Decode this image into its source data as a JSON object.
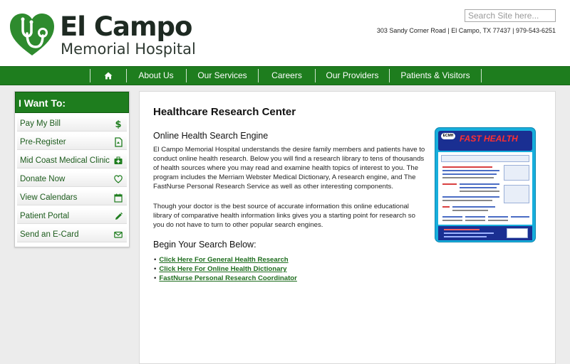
{
  "header": {
    "logo": {
      "name": "El Campo",
      "subtitle": "Memorial Hospital",
      "icon": "heart-stethoscope-icon"
    },
    "search": {
      "placeholder": "Search Site here...",
      "value": ""
    },
    "address": "303 Sandy Corner Road | El Campo, TX 77437 | 979-543-6251"
  },
  "nav": {
    "home_icon": "home-icon",
    "items": [
      "About Us",
      "Our Services",
      "Careers",
      "Our Providers",
      "Patients & Visitors"
    ]
  },
  "sidebar": {
    "title": "I Want To:",
    "items": [
      {
        "label": "Pay My Bill",
        "icon": "dollar-icon"
      },
      {
        "label": "Pre-Register",
        "icon": "document-icon"
      },
      {
        "label": "Mid Coast Medical Clinic",
        "icon": "medical-kit-icon"
      },
      {
        "label": "Donate Now",
        "icon": "heart-icon"
      },
      {
        "label": "View Calendars",
        "icon": "calendar-icon"
      },
      {
        "label": "Patient Portal",
        "icon": "pencil-icon"
      },
      {
        "label": "Send an E-Card",
        "icon": "envelope-icon"
      }
    ]
  },
  "main": {
    "title": "Healthcare Research Center",
    "section1_heading": "Online Health Search Engine",
    "paragraph1": "El Campo Memorial Hospital understands the desire family members and patients have to conduct online health research. Below you will find a research library to tens of thousands of health sources where you may read and examine health topics of interest to you. The program includes the Merriam Webster Medical Dictionary, A research engine, and The FastNurse Personal Research Service as well as other interesting components.",
    "paragraph2": "Though your doctor is the best source of accurate information this online educational library of comparative health information links gives you a starting point for research so you do not have to turn to other popular search engines.",
    "section2_heading": "Begin Your Search Below:",
    "links": [
      "Click Here For General Health Research",
      "Click Here For Online Health Dictionary",
      "FastNurse Personal Research Coordinator"
    ],
    "thumbnail": {
      "badge": "ECMH",
      "brand": "FAST HEALTH"
    }
  },
  "colors": {
    "brand_green": "#1e7d1e",
    "link_green": "#1e6d1e",
    "thumbnail_blue": "#17aedc"
  }
}
